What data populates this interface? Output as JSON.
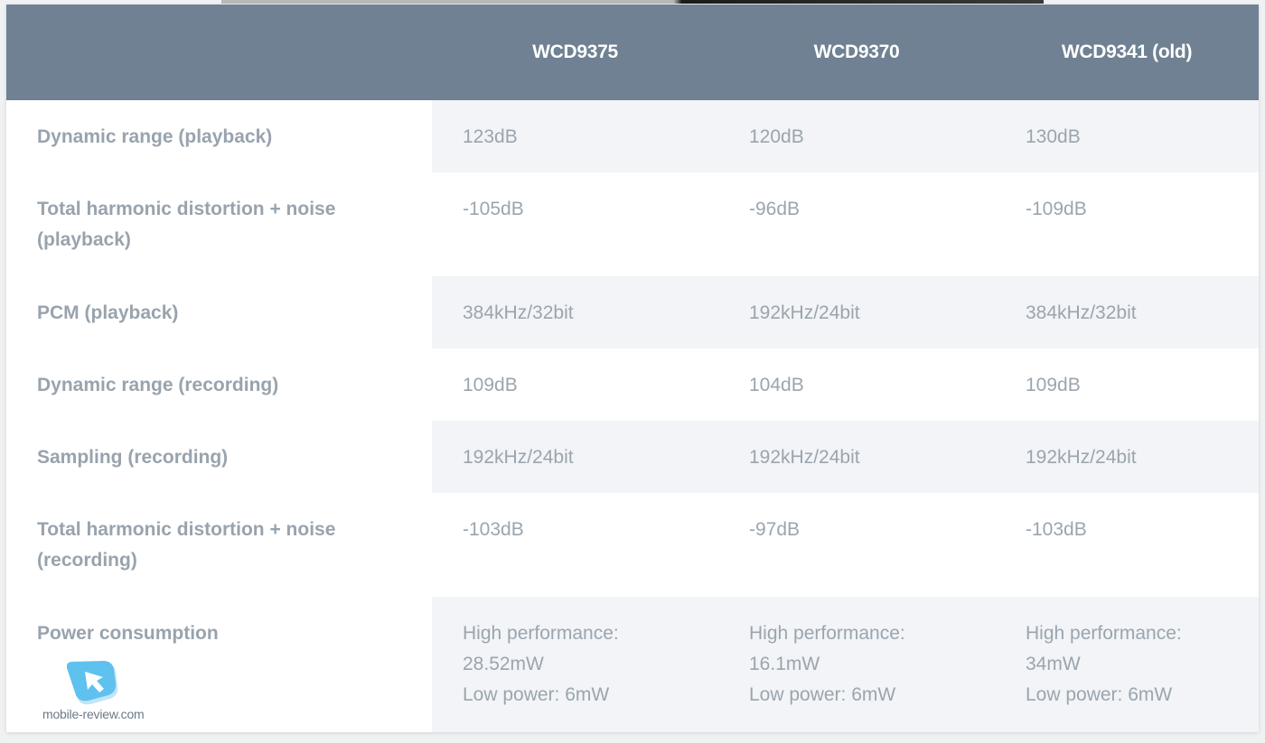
{
  "table": {
    "headers": [
      "",
      "WCD9375",
      "WCD9370",
      "WCD9341 (old)"
    ],
    "rows": [
      {
        "label": "Dynamic range (playback)",
        "values": [
          "123dB",
          "120dB",
          "130dB"
        ]
      },
      {
        "label": "Total harmonic distortion + noise (playback)",
        "values": [
          "-105dB",
          "-96dB",
          "-109dB"
        ]
      },
      {
        "label": "PCM (playback)",
        "values": [
          "384kHz/32bit",
          "192kHz/24bit",
          "384kHz/32bit"
        ]
      },
      {
        "label": "Dynamic range (recording)",
        "values": [
          "109dB",
          "104dB",
          "109dB"
        ]
      },
      {
        "label": "Sampling (recording)",
        "values": [
          "192kHz/24bit",
          "192kHz/24bit",
          "192kHz/24bit"
        ]
      },
      {
        "label": "Total harmonic distortion + noise (recording)",
        "values": [
          "-103dB",
          "-97dB",
          "-103dB"
        ]
      },
      {
        "label": "Power consumption",
        "values": [
          [
            "High performance:",
            "28.52mW",
            "Low power: 6mW"
          ],
          [
            "High performance:",
            "16.1mW",
            "Low power: 6mW"
          ],
          [
            "High performance:",
            "34mW",
            "Low power: 6mW"
          ]
        ]
      }
    ]
  },
  "watermark": {
    "text": "mobile-review.com",
    "icon": "mobile-review-logo-icon"
  },
  "colors": {
    "header_bg": "#6f8192",
    "shaded_cell_bg": "#f2f4f7",
    "text": "#9ba5ae"
  }
}
